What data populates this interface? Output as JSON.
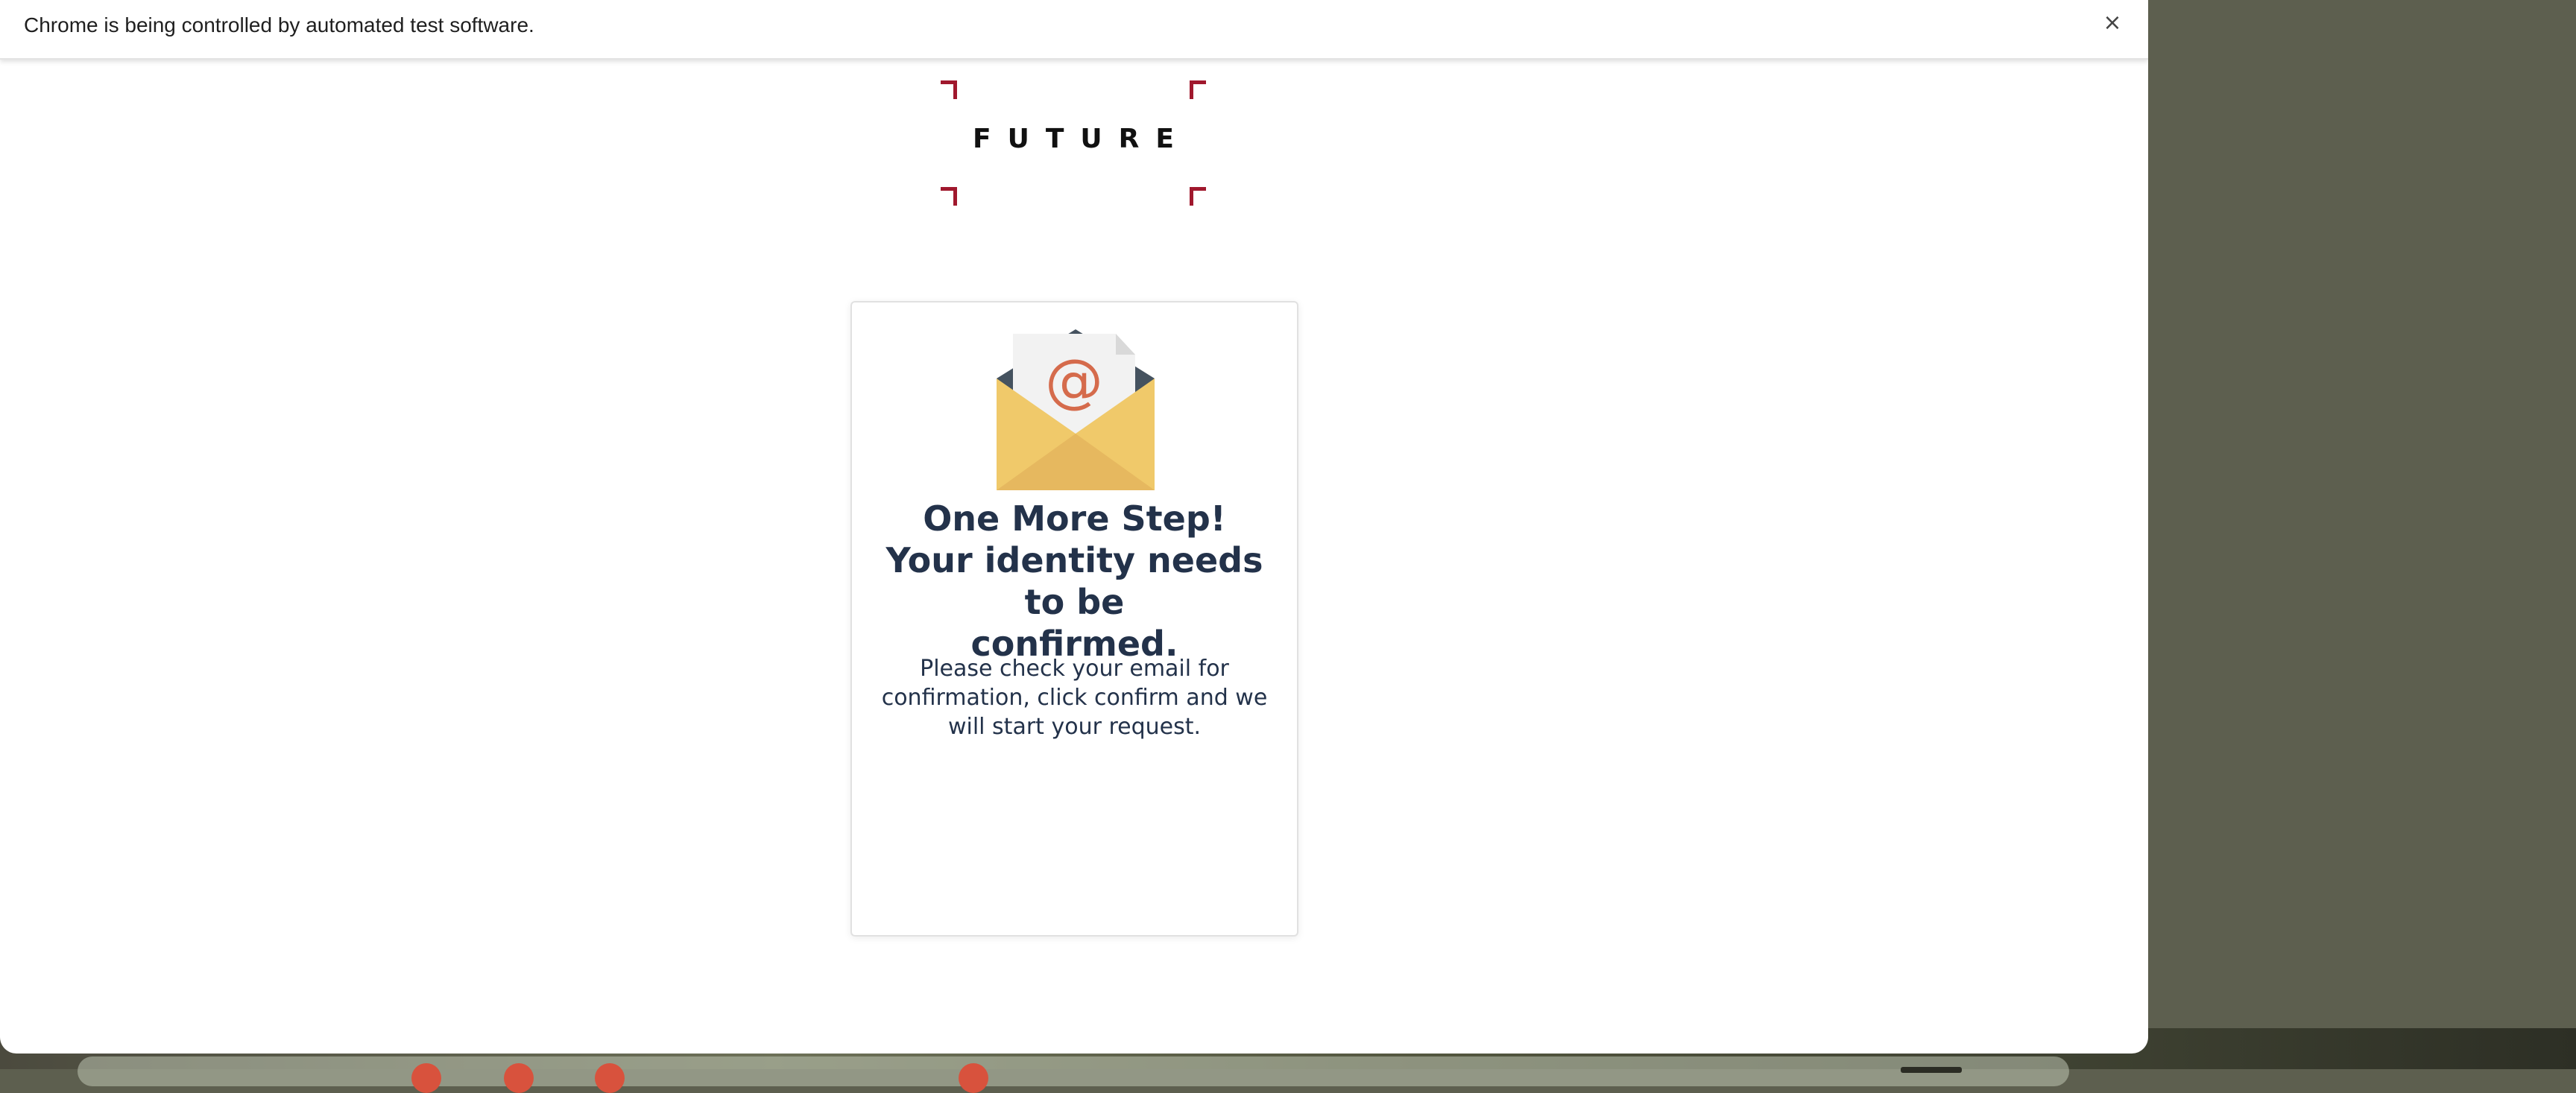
{
  "infobar": {
    "message": "Chrome is being controlled by automated test software.",
    "close_label": "×"
  },
  "logo": {
    "text": "FUTURE",
    "accent_color": "#a0182d"
  },
  "card": {
    "title_line1": "One More Step!",
    "title_line2": "Your identity needs to be",
    "title_line3": "confirmed.",
    "body": "Please check your email for confirmation, click confirm and we will start your request.",
    "envelope_symbol": "@"
  },
  "colors": {
    "text_dark": "#23324a",
    "envelope_yellow": "#f0c96a",
    "envelope_flap": "#45525f",
    "at_symbol": "#d56b4c"
  },
  "icons": [
    "close-icon",
    "envelope-email-icon",
    "future-logo"
  ]
}
